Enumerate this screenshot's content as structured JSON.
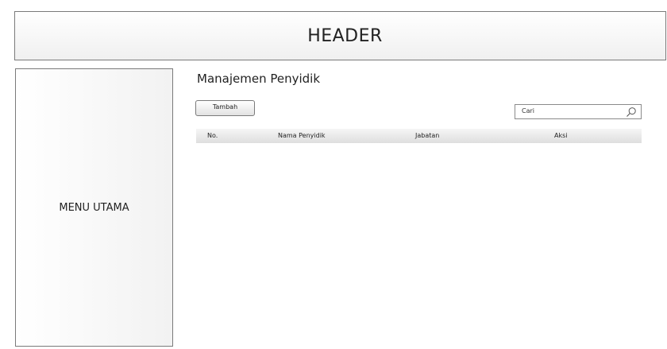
{
  "header": {
    "title": "HEADER"
  },
  "sidebar": {
    "label": "MENU UTAMA"
  },
  "main": {
    "title": "Manajemen Penyidik",
    "add_button_label": "Tambah",
    "search": {
      "value": "Cari",
      "icon": "search-icon"
    },
    "table": {
      "columns": [
        "No.",
        "Nama Penyidik",
        "Jabatan",
        "Aksi"
      ],
      "rows": []
    }
  }
}
